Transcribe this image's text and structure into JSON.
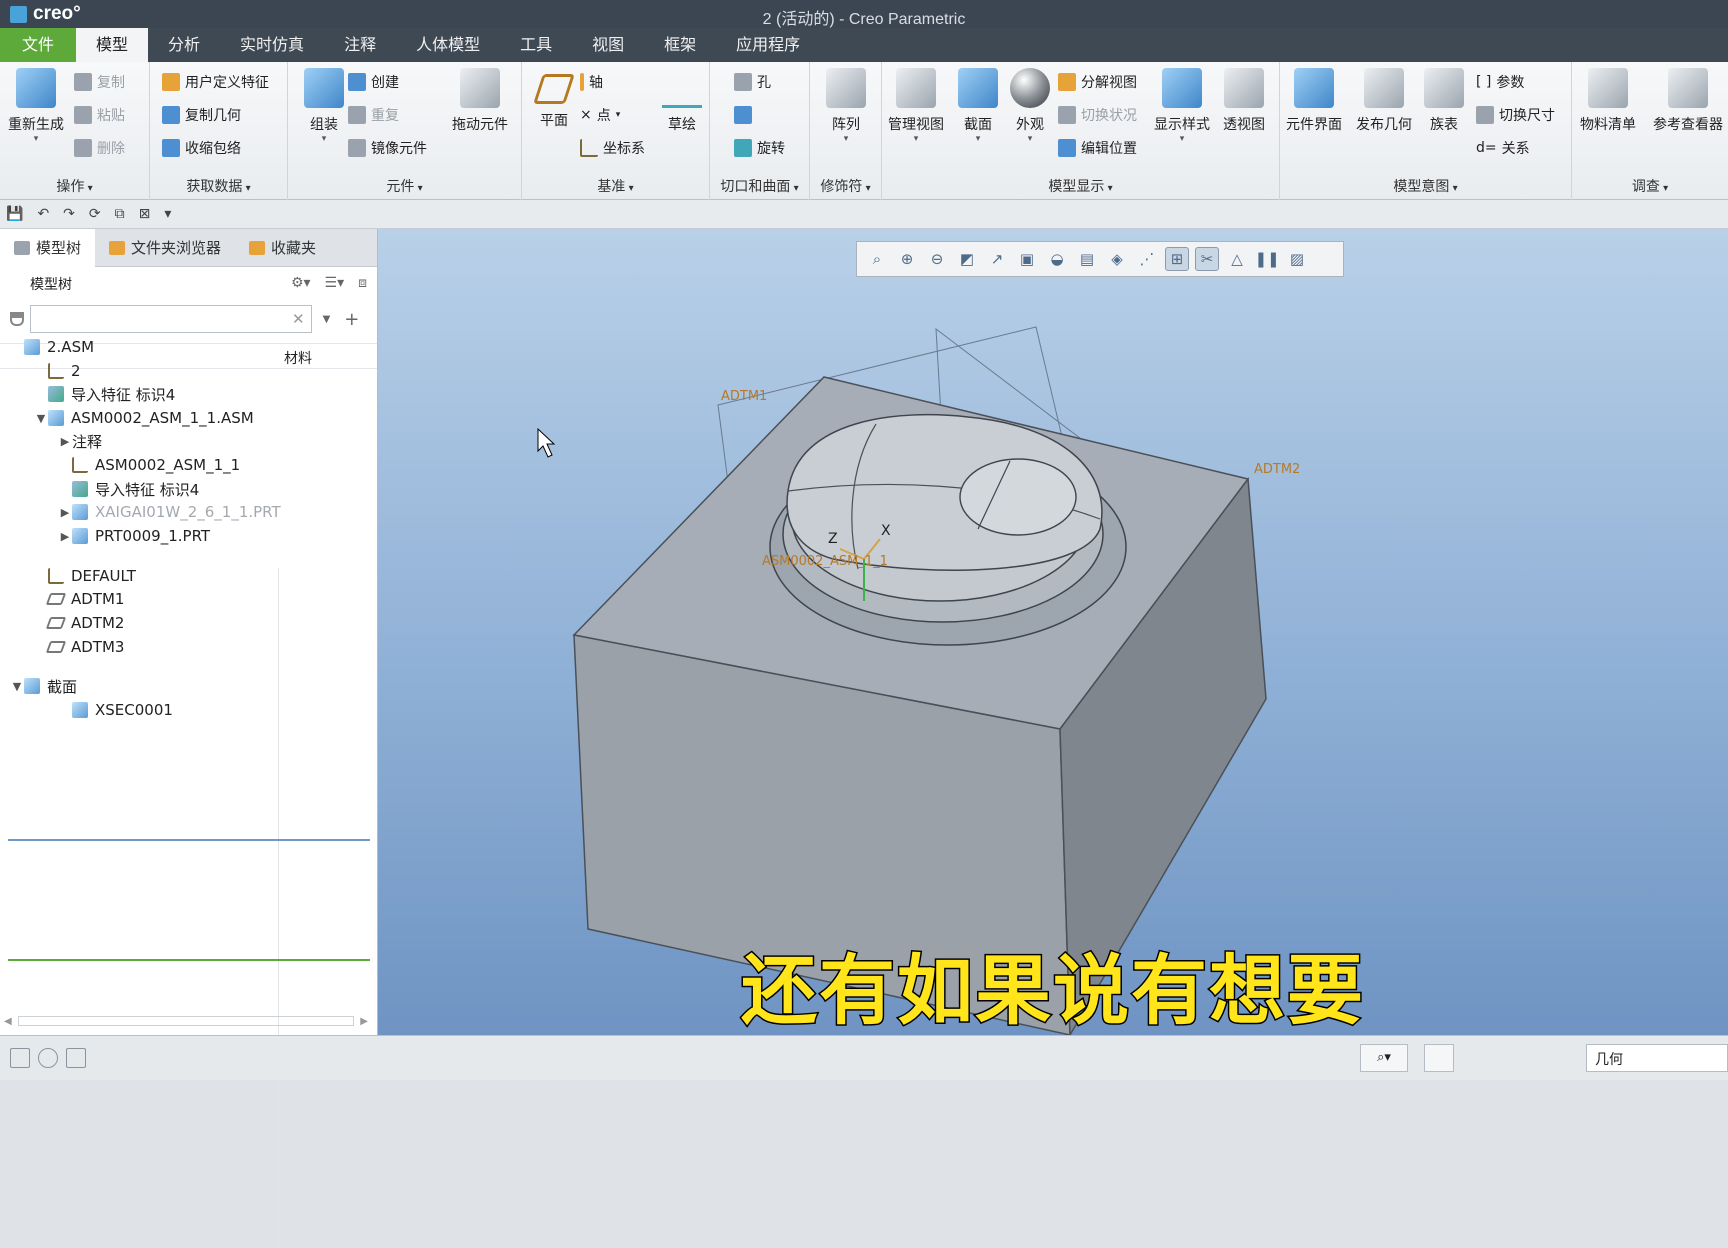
{
  "app": {
    "logo": "creo°",
    "window_title": "2 (活动的) - Creo Parametric"
  },
  "menu": {
    "tabs": [
      "文件",
      "模型",
      "分析",
      "实时仿真",
      "注释",
      "人体模型",
      "工具",
      "视图",
      "框架",
      "应用程序"
    ],
    "active_tab": "模型"
  },
  "ribbon": {
    "groups": {
      "operations": {
        "label": "操作",
        "regenerate": "重新生成",
        "copy": "复制",
        "paste": "粘贴",
        "delete": "删除"
      },
      "get_data": {
        "label": "获取数据",
        "user_defined_feature": "用户定义特征",
        "copy_geometry": "复制几何",
        "shrinkwrap": "收缩包络"
      },
      "component": {
        "label": "元件",
        "assemble": "组装",
        "create": "创建",
        "repeat": "重复",
        "mirror_component": "镜像元件",
        "drag_components": "拖动元件"
      },
      "datum": {
        "label": "基准",
        "plane": "平面",
        "axis": "轴",
        "point": "点",
        "csys": "坐标系",
        "sketch": "草绘"
      },
      "cut_surface": {
        "label": "切口和曲面",
        "hole": "孔",
        "revolve": "旋转"
      },
      "modifiers": {
        "label": "修饰符",
        "pattern": "阵列"
      },
      "model_display": {
        "label": "模型显示",
        "manage_views": "管理视图",
        "section": "截面",
        "appearance": "外观",
        "explode_view": "分解视图",
        "toggle_status": "切换状况",
        "edit_position": "编辑位置",
        "display_style": "显示样式",
        "perspective": "透视图"
      },
      "model_intent": {
        "label": "模型意图",
        "component_interface": "元件界面",
        "publish_geometry": "发布几何",
        "family_table": "族表",
        "parameters": "参数",
        "switch_dimensions": "切换尺寸",
        "relations": "关系"
      },
      "investigate": {
        "label": "调查",
        "bom": "物料清单",
        "reference_viewer": "参考查看器"
      }
    }
  },
  "panel": {
    "tabs": [
      "模型树",
      "文件夹浏览器",
      "收藏夹"
    ],
    "tree_title": "模型树",
    "column_material": "材料",
    "search_value": ""
  },
  "tree": {
    "rows": [
      {
        "label": "2.ASM",
        "indent": 0,
        "icon": "asm",
        "expander": ""
      },
      {
        "label": "2",
        "indent": 1,
        "icon": "csys",
        "expander": ""
      },
      {
        "label": "导入特征 标识4",
        "indent": 1,
        "icon": "imp",
        "expander": ""
      },
      {
        "label": "ASM0002_ASM_1_1.ASM",
        "indent": 1,
        "icon": "asm",
        "expander": "▼"
      },
      {
        "label": "注释",
        "indent": 2,
        "icon": "",
        "expander": "▶"
      },
      {
        "label": "ASM0002_ASM_1_1",
        "indent": 2,
        "icon": "csys",
        "expander": ""
      },
      {
        "label": "导入特征 标识4",
        "indent": 2,
        "icon": "imp",
        "expander": ""
      },
      {
        "label": "XAIGAI01W_2_6_1_1.PRT",
        "indent": 2,
        "icon": "asm",
        "expander": "▶",
        "dim": true
      },
      {
        "label": "PRT0009_1.PRT",
        "indent": 2,
        "icon": "asm",
        "expander": "▶"
      },
      {
        "label": "DEFAULT",
        "indent": 1,
        "icon": "csys",
        "expander": ""
      },
      {
        "label": "ADTM1",
        "indent": 1,
        "icon": "dtm",
        "expander": ""
      },
      {
        "label": "ADTM2",
        "indent": 1,
        "icon": "dtm",
        "expander": ""
      },
      {
        "label": "ADTM3",
        "indent": 1,
        "icon": "dtm",
        "expander": ""
      },
      {
        "label": "截面",
        "indent": 0,
        "icon": "asm",
        "expander": "▼"
      },
      {
        "label": "XSEC0001",
        "indent": 2,
        "icon": "asm",
        "expander": ""
      }
    ]
  },
  "viewport": {
    "datum_labels": [
      "ADTM1",
      "ADTM2"
    ],
    "csys_label": "ASM0002_ASM_1_1",
    "axis_x": "X",
    "axis_z": "Z",
    "subtitle": "还有如果说有想要"
  },
  "status": {
    "filter_value": "几何"
  },
  "colors": {
    "title_bg": "#3b4652",
    "file_tab": "#5daa3b",
    "viewport_top": "#b9d0e8",
    "viewport_bottom": "#6f94c3",
    "subtitle": "#ffe51a"
  }
}
